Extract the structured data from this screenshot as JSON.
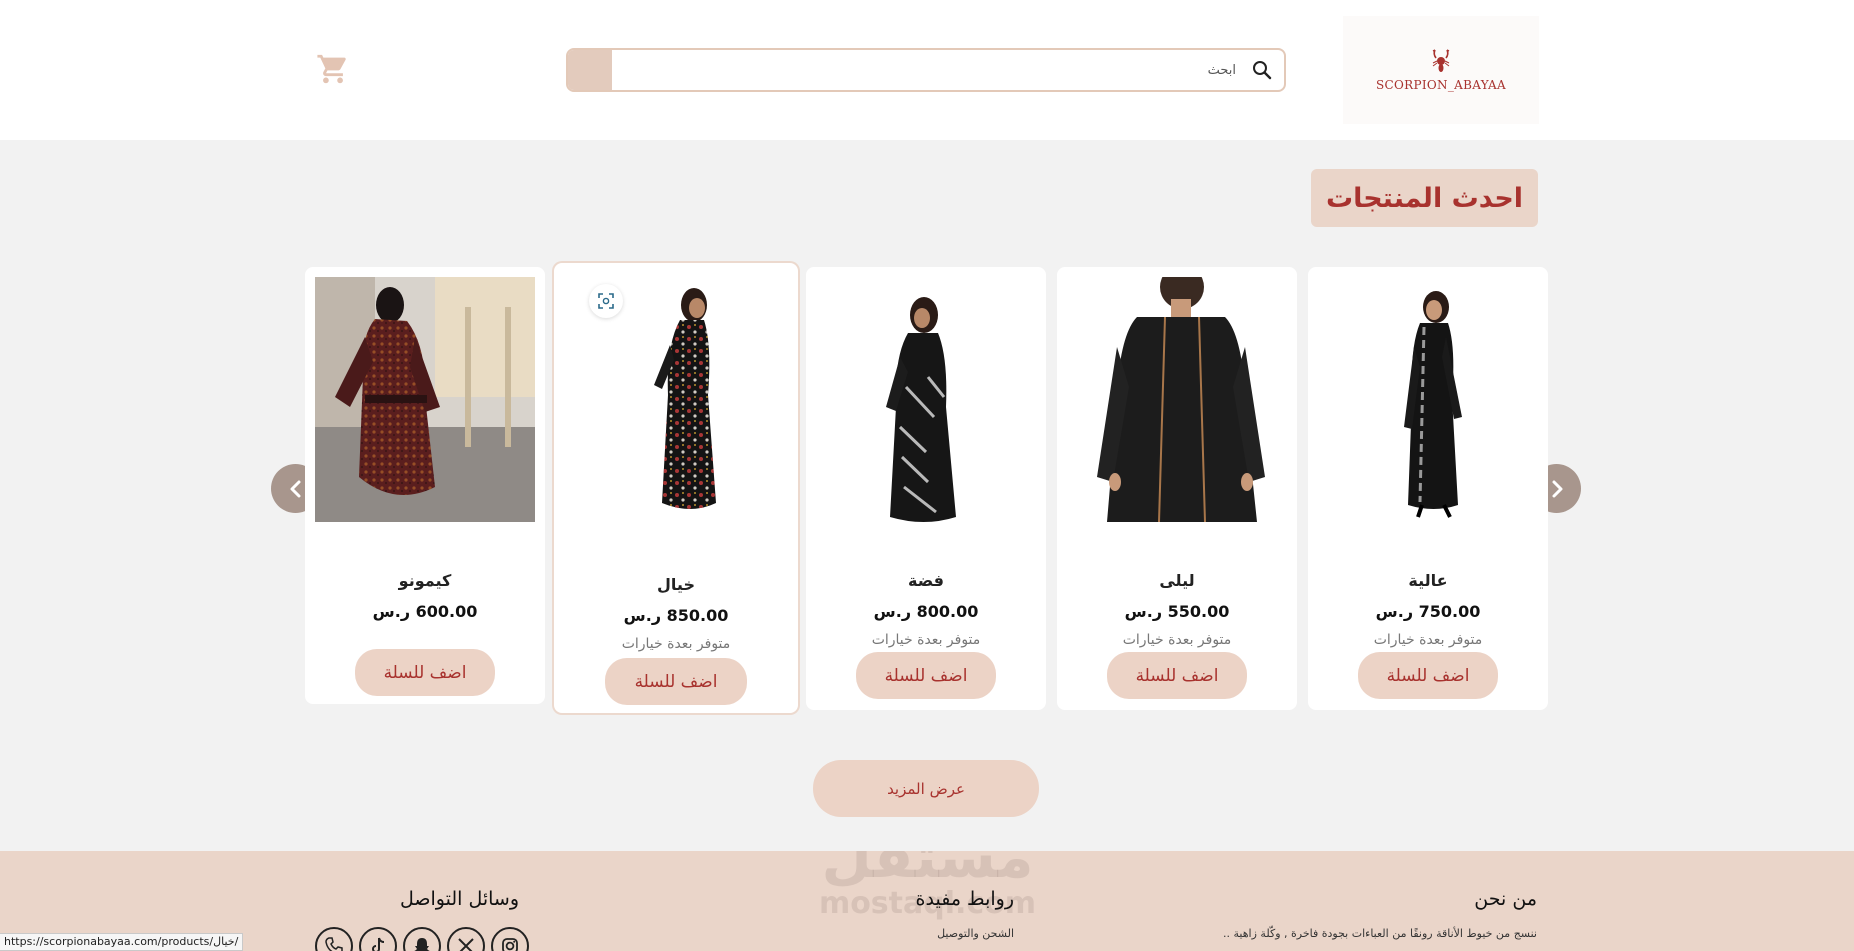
{
  "header": {
    "logo_text": "SCORPION_ABAYAA",
    "search_placeholder": "ابحث"
  },
  "section_title": "احدث المنتجات",
  "products": [
    {
      "name": "كيمونو",
      "price": "600.00 ر.س",
      "availability": "",
      "button": "اضف للسلة"
    },
    {
      "name": "خيال",
      "price": "850.00 ر.س",
      "availability": "متوفر بعدة خيارات",
      "button": "اضف للسلة"
    },
    {
      "name": "فضة",
      "price": "800.00 ر.س",
      "availability": "متوفر بعدة خيارات",
      "button": "اضف للسلة"
    },
    {
      "name": "ليلى",
      "price": "550.00 ر.س",
      "availability": "متوفر بعدة خيارات",
      "button": "اضف للسلة"
    },
    {
      "name": "عالية",
      "price": "750.00 ر.س",
      "availability": "متوفر بعدة خيارات",
      "button": "اضف للسلة"
    }
  ],
  "more_button": "عرض المزيد",
  "footer": {
    "about_title": "من نحن",
    "about_text": "ننسج من خيوط الأناقة رونقًا من العباءات بجودة فاخرة , وكّلة زاهية ..",
    "links_title": "روابط مفيدة",
    "links_first": "الشحن والتوصيل",
    "social_title": "وسائل التواصل",
    "social_icons": [
      "phone-icon",
      "tiktok-icon",
      "snapchat-icon",
      "x-icon",
      "instagram-icon"
    ]
  },
  "watermark": {
    "arabic": "مستقل",
    "latin": "mostaql.com"
  },
  "status_url": "https://scorpionabayaa.com/products/خيال/",
  "colors": {
    "accent": "#a8322e",
    "beige": "#ead5c9",
    "arrow": "#a8968d"
  }
}
